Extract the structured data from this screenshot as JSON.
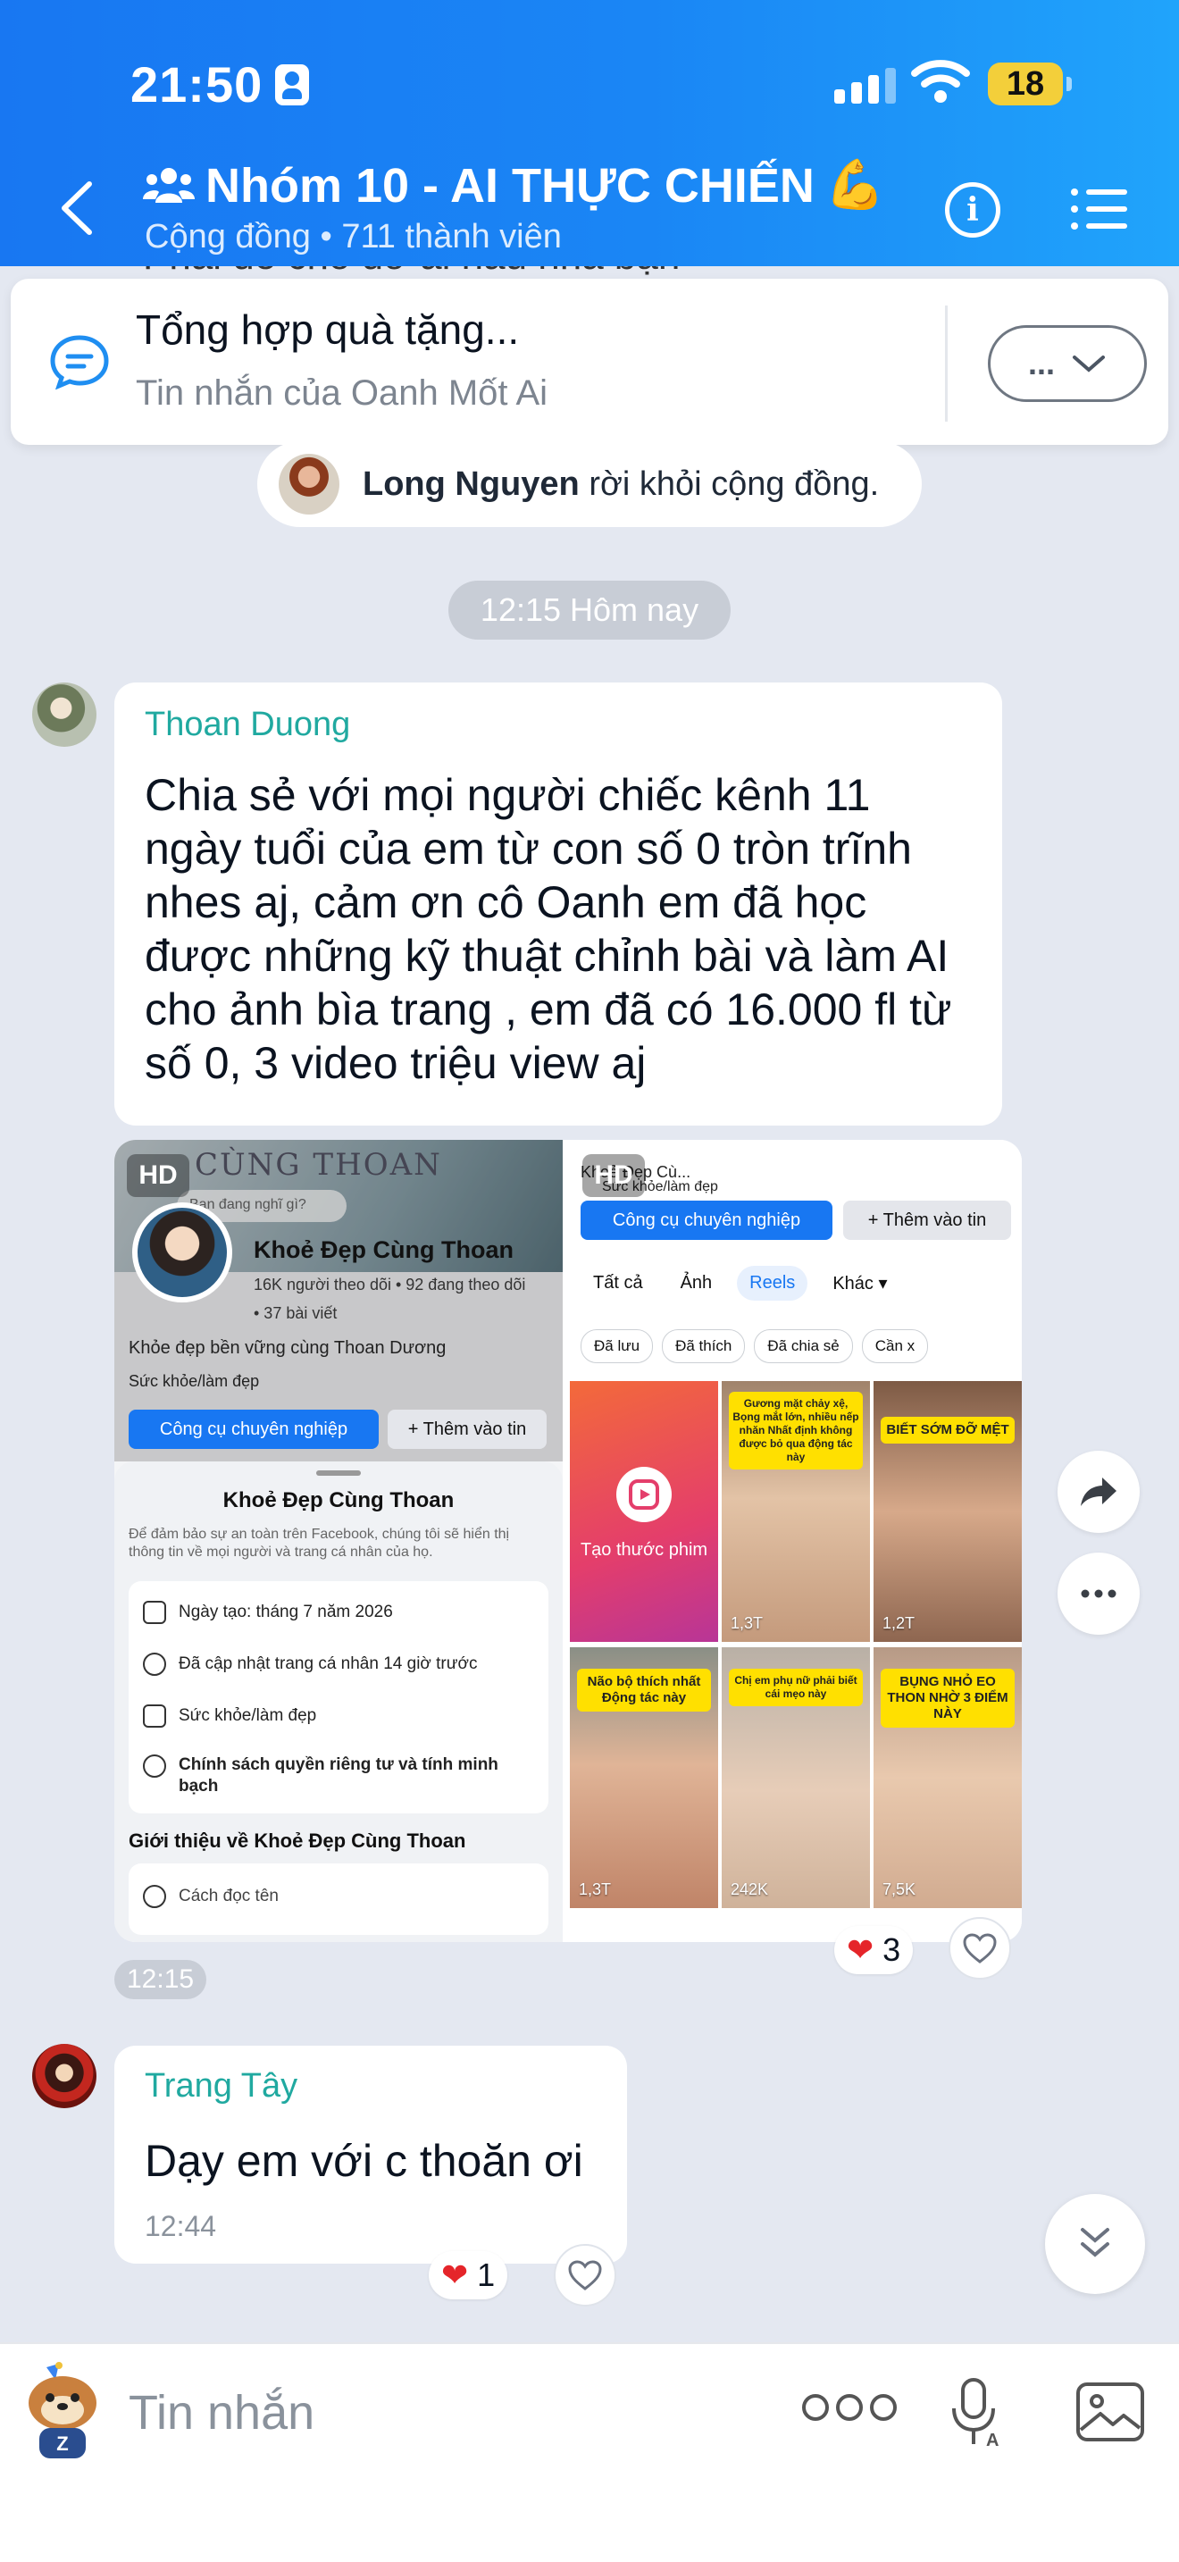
{
  "status_bar": {
    "time": "21:50",
    "battery": "18"
  },
  "header": {
    "title": "Nhóm 10 - AI THỰC CHIẾN",
    "title_emoji": "💪",
    "subtitle": "Cộng đồng • 711 thành viên"
  },
  "peek_text": "Phải để cho đỡ ái náu nha bạn",
  "pinned": {
    "title": "Tổng hợp quà tặng...",
    "subtitle": "Tin nhắn của Oanh Mốt Ai",
    "more_label": "..."
  },
  "notice": {
    "name": "Long Nguyen",
    "text": "rời khỏi cộng đồng."
  },
  "date_chip": "12:15 Hôm nay",
  "messages": [
    {
      "sender": "Thoan Duong",
      "text": "Chia sẻ với mọi người chiếc kênh 11 ngày tuổi của em từ con số 0 tròn trĩnh nhes aj, cảm ơn cô Oanh  em đã học được những kỹ thuật chỉnh bài và làm AI cho ảnh bìa trang , em đã có 16.000 fl từ số 0, 3 video triệu view aj",
      "time": "12:15",
      "reaction_count": "3"
    },
    {
      "sender": "Trang Tây",
      "text": "Dạy em với c thoăn ơi",
      "time": "12:44",
      "reaction_count": "1"
    }
  ],
  "image_left": {
    "hd": "HD",
    "cover_text": "CÙNG THOAN",
    "status_prompt": "Bạn đang nghĩ gì?",
    "page_name": "Khoẻ Đẹp Cùng Thoan",
    "followers": "16K người theo dõi • 92 đang theo dõi",
    "posts": "• 37 bài viết",
    "bio": "Khỏe đẹp bền vững cùng Thoan Dương",
    "category": "Sức khỏe/làm đẹp",
    "btn_pro": "Công cụ chuyên nghiệp",
    "btn_add": "+ Thêm vào tin",
    "sheet_title": "Khoẻ Đẹp Cùng Thoan",
    "sheet_desc": "Để đảm bảo sự an toàn trên Facebook, chúng tôi sẽ hiển thị thông tin về mọi người và trang cá nhân của họ.",
    "rows": [
      "Ngày tạo: tháng 7 năm 2026",
      "Đã cập nhật trang cá nhân 14 giờ trước",
      "Sức khỏe/làm đẹp",
      "Chính sách quyền riêng tư và tính minh bạch"
    ],
    "intro_title": "Giới thiệu về Khoẻ Đẹp Cùng Thoan",
    "intro_row": "Cách đọc tên"
  },
  "image_right": {
    "hd": "HD",
    "top_text": "Khoẻ Đẹp Cù...",
    "category": "Sức khỏe/làm đẹp",
    "btn_pro": "Công cụ chuyên nghiệp",
    "btn_add": "+ Thêm vào tin",
    "tabs": [
      "Tất cả",
      "Ảnh",
      "Reels",
      "Khác ▾"
    ],
    "chips": [
      "Đã lưu",
      "Đã thích",
      "Đã chia sẻ",
      "Cần x"
    ],
    "make_reel": "Tạo thước phim",
    "tiles": [
      {
        "caption": "Gương mặt chảy xệ, Bọng mắt lớn, nhiều nếp nhăn Nhất định không được bỏ qua động tác này",
        "views": "1,3T"
      },
      {
        "caption": "BIẾT SỚM ĐỠ MỆT",
        "views": "1,2T"
      },
      {
        "caption": "Não bộ thích nhất Động tác này",
        "views": "1,3T"
      },
      {
        "caption": "Chị em phụ nữ phải biết cái mẹo này",
        "views": "242K"
      },
      {
        "caption": "BỤNG NHỎ EO THON NHỜ 3 ĐIỂM NÀY",
        "views": "7,5K"
      }
    ]
  },
  "input": {
    "placeholder": "Tin nhắn"
  },
  "colors": {
    "header_start": "#1877f2",
    "header_end": "#20a4fb",
    "sender": "#20a9a0",
    "background": "#e4e8f1"
  }
}
